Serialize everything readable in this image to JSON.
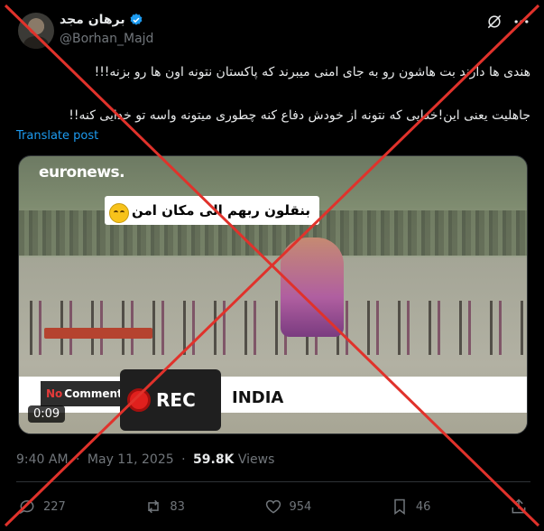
{
  "author": {
    "name": "برهان مجد",
    "handle": "@Borhan_Majd"
  },
  "tweet": {
    "line1": "هندی ها دارند بت هاشون رو به جای امنی میبرند که پاکستان نتونه اون ها رو بزنه!!!",
    "line2": "جاهلیت یعنی این!خدایی که نتونه از خودش دفاع کنه چطوری میتونه واسه تو خدایی کنه!!",
    "translate_label": "Translate post"
  },
  "media": {
    "brand": "euronews.",
    "caption": "بنقلون ربهم الی مکان امن",
    "badge_prefix": "No",
    "badge_label": "Comment",
    "rec_label": "REC",
    "country_label": "INDIA",
    "duration": "0:09"
  },
  "meta": {
    "time": "9:40 AM",
    "date": "May 11, 2025",
    "views_count": "59.8K",
    "views_label": "Views"
  },
  "actions": {
    "replies": "227",
    "reposts": "83",
    "likes": "954",
    "bookmarks": "46"
  },
  "colors": {
    "background": "#000000",
    "text": "#e7e9ea",
    "muted": "#71767b",
    "link": "#1d9bf0",
    "overlay_x": "#e0322b"
  }
}
